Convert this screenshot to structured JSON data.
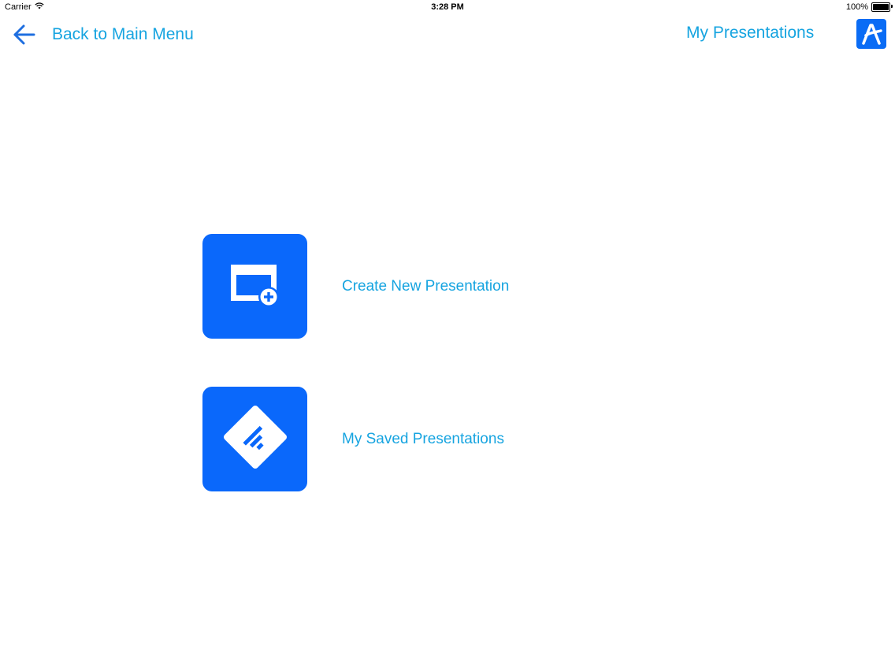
{
  "status_bar": {
    "carrier": "Carrier",
    "time": "3:28 PM",
    "battery": "100%",
    "icons": [
      "wifi-icon",
      "battery-icon"
    ]
  },
  "nav": {
    "back_label": "Back to Main Menu",
    "back_icon": "arrow-left-icon",
    "title": "My Presentations",
    "logo_icon": "app-logo-icon"
  },
  "options": [
    {
      "label": "Create New Presentation",
      "icon": "new-presentation-icon"
    },
    {
      "label": "My Saved Presentations",
      "icon": "saved-presentations-icon"
    }
  ],
  "colors": {
    "accent_text": "#16a4e0",
    "tile_blue": "#0a68fb",
    "back_arrow": "#1f6fe0",
    "background": "#ffffff"
  }
}
